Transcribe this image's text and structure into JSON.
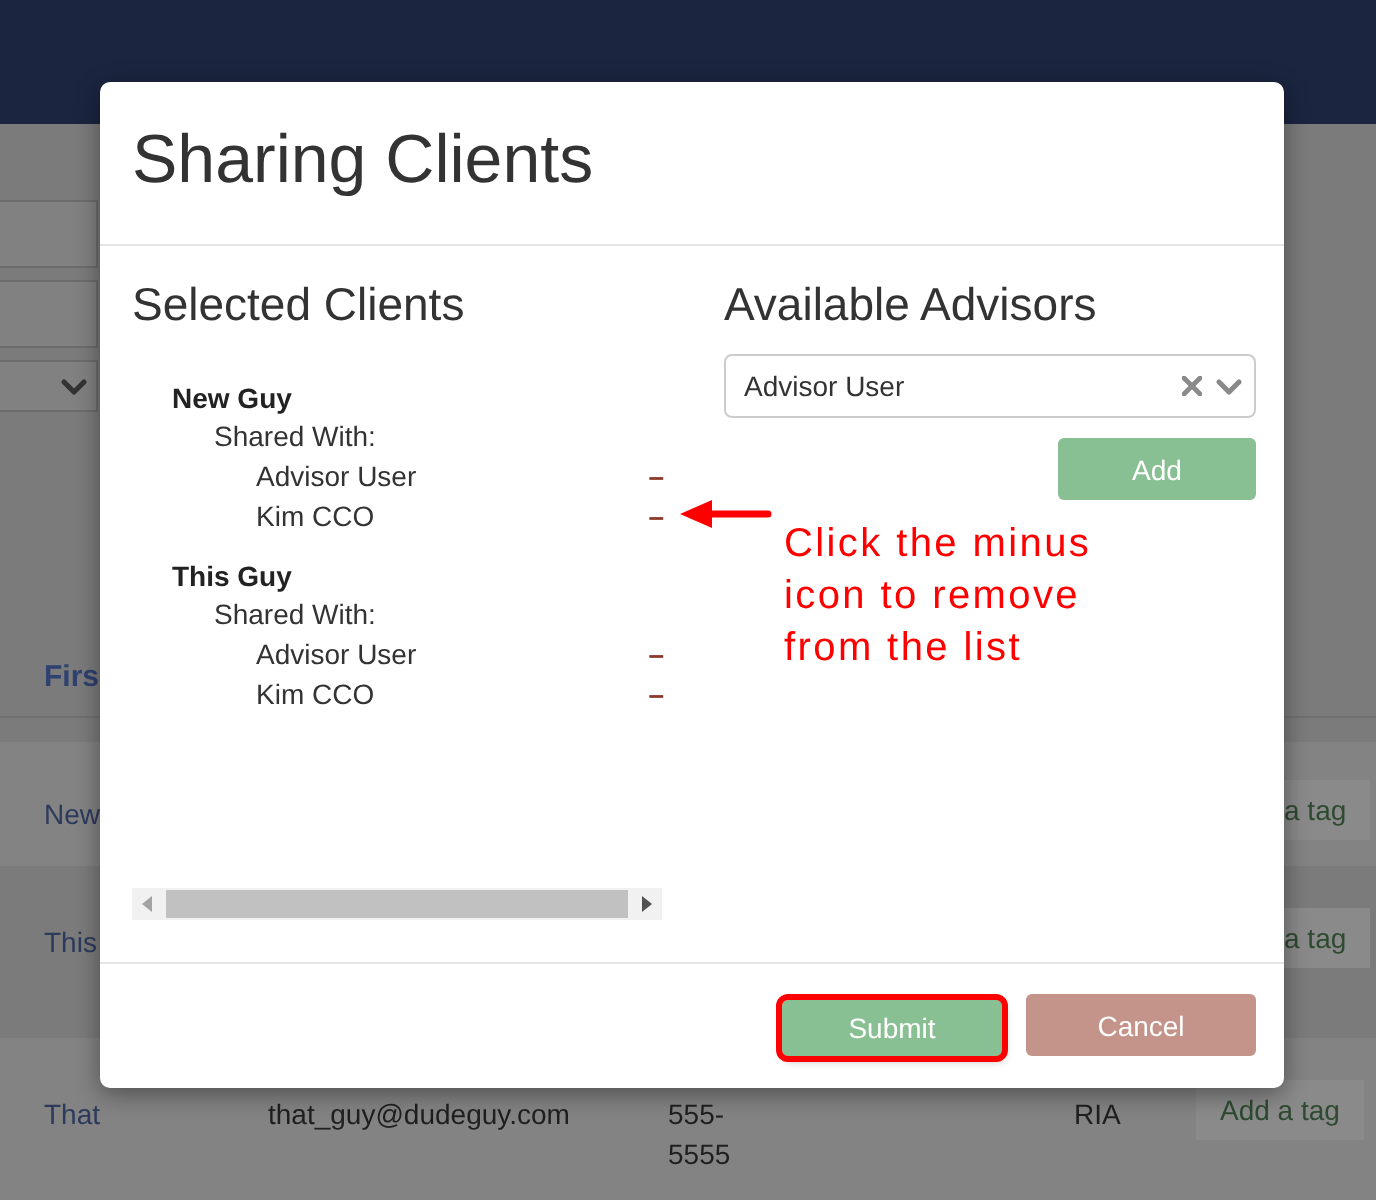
{
  "background": {
    "filters": [
      {
        "kind": "field"
      },
      {
        "kind": "field"
      },
      {
        "kind": "select"
      }
    ],
    "table": {
      "columns": [
        "Firs"
      ],
      "rows": [
        {
          "kind": "covered",
          "first": "New",
          "tag": "a tag"
        },
        {
          "kind": "covered",
          "first": "This",
          "tag": "a tag"
        },
        {
          "kind": "full",
          "first": "That",
          "email": "that_guy@dudeguy.com",
          "phone": "555-5555",
          "type": "RIA",
          "tag": "Add a tag"
        }
      ]
    }
  },
  "dialog": {
    "title": "Sharing Clients",
    "selected_clients": {
      "heading": "Selected Clients",
      "clients": [
        {
          "name": "New Guy",
          "shared_label": "Shared With:",
          "advisors": [
            {
              "name": "Advisor User",
              "remove": "–"
            },
            {
              "name": "Kim CCO",
              "remove": "–"
            }
          ]
        },
        {
          "name": "This Guy",
          "shared_label": "Shared With:",
          "advisors": [
            {
              "name": "Advisor User",
              "remove": "–"
            },
            {
              "name": "Kim CCO",
              "remove": "–"
            }
          ]
        }
      ]
    },
    "available_advisors": {
      "heading": "Available Advisors",
      "select_value": "Advisor User",
      "add_button": "Add"
    },
    "buttons": [
      {
        "label": "Submit",
        "kind": "submit",
        "highlighted": true
      },
      {
        "label": "Cancel",
        "kind": "cancel",
        "highlighted": false
      }
    ]
  },
  "annotation": {
    "text": "Click the minus icon to remove from the list"
  }
}
